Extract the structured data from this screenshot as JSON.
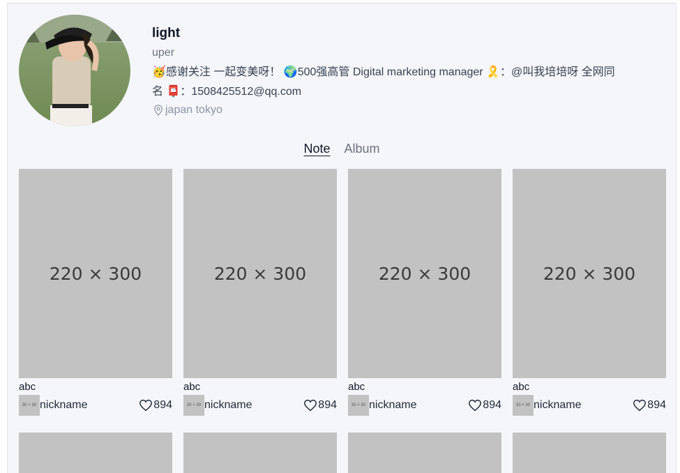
{
  "profile": {
    "name": "light",
    "role": "uper",
    "bio_line1": "🥳感谢关注 一起变美呀！ 🌍500强高管 Digital marketing manager 🎗️：@叫我培培呀 全网同",
    "bio_line2": "名 📮：1508425512@qq.com",
    "location": "japan tokyo"
  },
  "tabs": {
    "note": "Note",
    "album": "Album"
  },
  "cards": [
    {
      "image_text": "220 × 300",
      "title": "abc",
      "avatar_text": "30 × 30",
      "nickname": "nickname",
      "likes": "894"
    },
    {
      "image_text": "220 × 300",
      "title": "abc",
      "avatar_text": "30 × 30",
      "nickname": "nickname",
      "likes": "894"
    },
    {
      "image_text": "220 × 300",
      "title": "abc",
      "avatar_text": "30 × 30",
      "nickname": "nickname",
      "likes": "894"
    },
    {
      "image_text": "220 × 300",
      "title": "abc",
      "avatar_text": "30 × 30",
      "nickname": "nickname",
      "likes": "894"
    }
  ],
  "colors": {
    "page_bg": "#f5f6fa",
    "placeholder": "#c2c2c2",
    "muted": "#6b7280"
  }
}
